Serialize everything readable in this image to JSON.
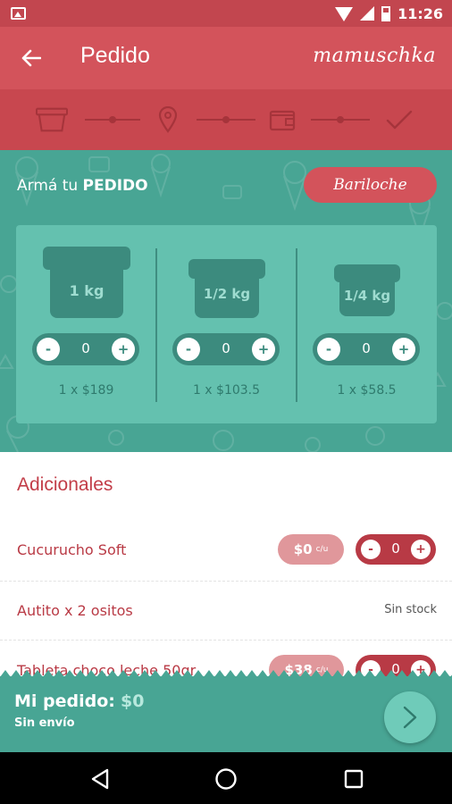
{
  "status_bar": {
    "time": "11:26"
  },
  "app_bar": {
    "title": "Pedido",
    "logo": "mamuschka"
  },
  "steps": [
    {
      "icon": "ice-cream-tub-icon",
      "active": true
    },
    {
      "icon": "location-pin-icon",
      "active": false
    },
    {
      "icon": "wallet-icon",
      "active": false
    },
    {
      "icon": "checkmark-icon",
      "active": false
    }
  ],
  "order_builder": {
    "title_prefix": "Armá tu ",
    "title_bold": "PEDIDO",
    "store": "Bariloche",
    "sizes": [
      {
        "label": "1 kg",
        "quantity": "0",
        "price": "1 x $189",
        "minus": "-",
        "plus": "+"
      },
      {
        "label": "1/2 kg",
        "quantity": "0",
        "price": "1 x $103.5",
        "minus": "-",
        "plus": "+"
      },
      {
        "label": "1/4 kg",
        "quantity": "0",
        "price": "1 x $58.5",
        "minus": "-",
        "plus": "+"
      }
    ]
  },
  "extras": {
    "title": "Adicionales",
    "items": [
      {
        "name": "Cucurucho Soft",
        "price": "$0",
        "price_suffix": "c/u",
        "quantity": "0",
        "minus": "-",
        "plus": "+"
      },
      {
        "name": "Autito x 2 ositos",
        "stock": "Sin stock"
      },
      {
        "name": "Tableta choco leche 50gr",
        "price": "$38",
        "price_suffix": "c/u",
        "quantity": "0",
        "minus": "-",
        "plus": "+"
      }
    ]
  },
  "summary": {
    "label": "Mi pedido:",
    "total": "$0",
    "shipping": "Sin envío"
  },
  "colors": {
    "primary": "#d3535b",
    "primary_dark": "#c2464f",
    "teal": "#48a594",
    "teal_card": "#64c1af",
    "teal_dark": "#3c8b7e"
  }
}
